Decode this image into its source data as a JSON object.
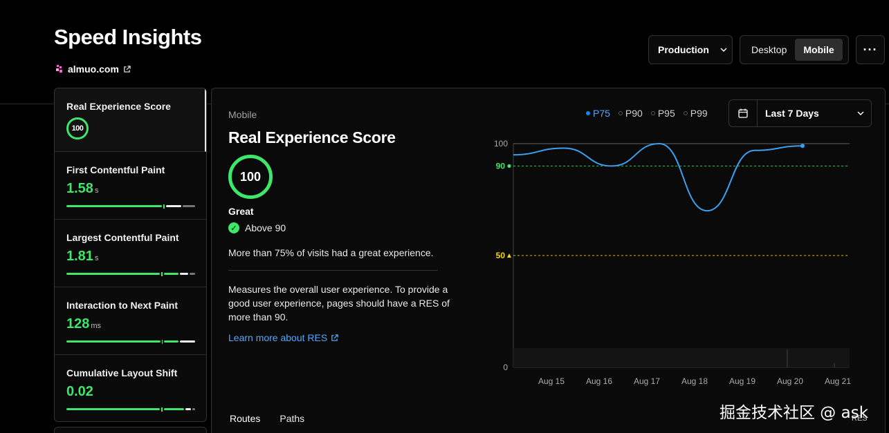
{
  "header": {
    "title": "Speed Insights",
    "site": "almuo.com"
  },
  "toolbar": {
    "environment": "Production",
    "device_options": [
      "Desktop",
      "Mobile"
    ],
    "device_selected": "Mobile",
    "more_label": "···"
  },
  "sidebar": {
    "items": [
      {
        "label": "Real Experience Score",
        "value": "100",
        "unit": ""
      },
      {
        "label": "First Contentful Paint",
        "value": "1.58",
        "unit": "s"
      },
      {
        "label": "Largest Contentful Paint",
        "value": "1.81",
        "unit": "s"
      },
      {
        "label": "Interaction to Next Paint",
        "value": "128",
        "unit": "ms"
      },
      {
        "label": "Cumulative Layout Shift",
        "value": "0.02",
        "unit": ""
      }
    ]
  },
  "panel": {
    "device": "Mobile",
    "title": "Real Experience Score",
    "score": "100",
    "rating": "Great",
    "threshold": "Above 90",
    "summary": "More than 75% of visits had a great experience.",
    "description": "Measures the overall user experience. To provide a good user experience, pages should have a RES of more than 90.",
    "learn_more": "Learn more about RES",
    "percentiles": [
      "P75",
      "P90",
      "P95",
      "P99"
    ],
    "percentile_selected": "P75",
    "date_range": "Last 7 Days",
    "tabs": [
      "Routes",
      "Paths"
    ],
    "res_corner": "RES"
  },
  "chart_data": {
    "type": "line",
    "x": [
      "Aug 15",
      "Aug 16",
      "Aug 17",
      "Aug 18",
      "Aug 19",
      "Aug 20",
      "Aug 21"
    ],
    "series": [
      {
        "name": "P75",
        "values": [
          98,
          90,
          100,
          70,
          97,
          99,
          null
        ]
      }
    ],
    "ylim": [
      0,
      100
    ],
    "yticks": [
      "100",
      "0"
    ],
    "thresholds": [
      {
        "label": "90",
        "value": 90,
        "color": "#3ee66a"
      },
      {
        "label": "50",
        "value": 50,
        "color": "#f5d90a"
      }
    ],
    "line_color": "#3aa0f0"
  },
  "watermark": "掘金技术社区 @ ask"
}
